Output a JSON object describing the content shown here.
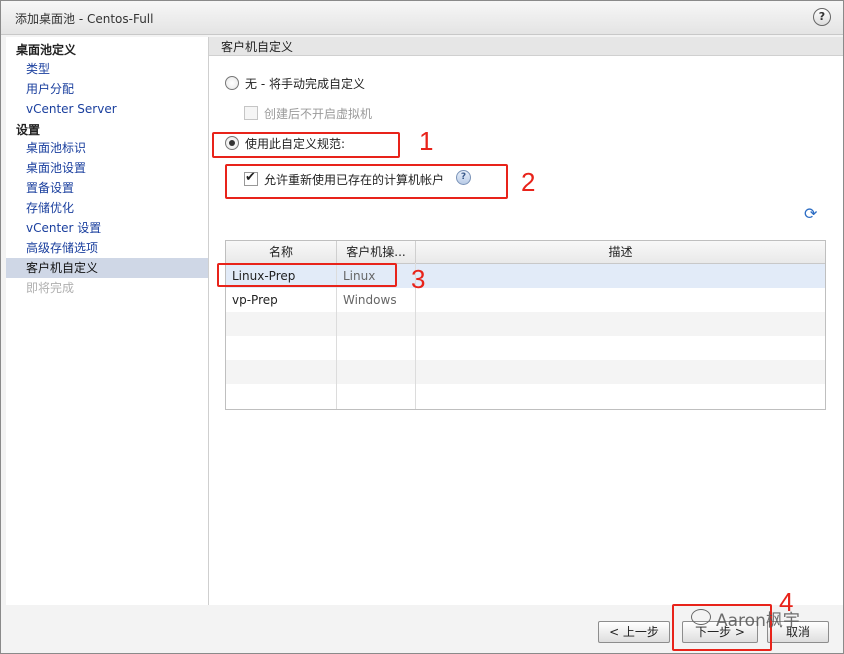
{
  "window": {
    "title": "添加桌面池 - Centos-Full"
  },
  "sidebar": {
    "sections": [
      {
        "heading": "桌面池定义",
        "items": [
          {
            "label": "类型"
          },
          {
            "label": "用户分配"
          },
          {
            "label": "vCenter Server"
          }
        ]
      },
      {
        "heading": "设置",
        "items": [
          {
            "label": "桌面池标识"
          },
          {
            "label": "桌面池设置"
          },
          {
            "label": "置备设置"
          },
          {
            "label": "存储优化"
          },
          {
            "label": "vCenter 设置"
          },
          {
            "label": "高级存储选项"
          },
          {
            "label": "客户机自定义",
            "active": true
          },
          {
            "label": "即将完成",
            "disabled": true
          }
        ]
      }
    ]
  },
  "content": {
    "header": "客户机自定义",
    "option_none": "无 - 将手动完成自定义",
    "option_none_sub": "创建后不开启虚拟机",
    "option_spec": "使用此自定义规范:",
    "allow_reuse": "允许重新使用已存在的计算机帐户",
    "table": {
      "columns": [
        "名称",
        "客户机操...",
        "描述"
      ],
      "rows": [
        {
          "name": "Linux-Prep",
          "os": "Linux",
          "desc": ""
        },
        {
          "name": "vp-Prep",
          "os": "Windows",
          "desc": ""
        }
      ]
    }
  },
  "footer": {
    "prev": "< 上一步",
    "next": "下一步 >",
    "cancel": "取消"
  },
  "annotations": {
    "n1": "1",
    "n2": "2",
    "n3": "3",
    "n4": "4",
    "color": "#e8231a"
  },
  "watermark": {
    "text": "Aaron枫宇"
  },
  "icons": {
    "help": "help-icon",
    "info": "info-icon",
    "refresh": "refresh-icon"
  }
}
